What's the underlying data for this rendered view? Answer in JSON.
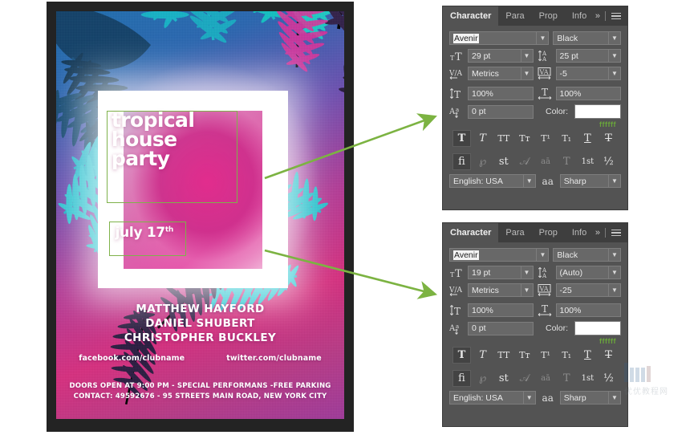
{
  "poster": {
    "title_lines": [
      "tropical",
      "house",
      "party"
    ],
    "date_text": "july 17",
    "date_sup": "th",
    "artists": [
      "MATTHEW HAYFORD",
      "DANIEL SHUBERT",
      "CHRISTOPHER BUCKLEY"
    ],
    "socials": [
      "facebook.com/clubname",
      "twitter.com/clubname"
    ],
    "footer_lines": [
      "DOORS OPEN AT 9:00 PM - SPECIAL PERFORMANS -FREE PARKING",
      "CONTACT: 49592676 - 95 STREETS MAIN ROAD, NEW YORK CITY"
    ],
    "selection_outline_color": "#7fb24a"
  },
  "annotation": {
    "arrow_color": "#7cb342",
    "arrow_count": 2
  },
  "panels": [
    {
      "id": "character-panel-title",
      "tabs": [
        {
          "label": "Character",
          "active": true
        },
        {
          "label": "Para",
          "active": false
        },
        {
          "label": "Prop",
          "active": false
        },
        {
          "label": "Info",
          "active": false
        }
      ],
      "expand_icon": "»",
      "menu_icon": "hamburger-menu-icon",
      "font_family": "Avenir",
      "font_style": "Black",
      "font_size": "29 pt",
      "leading": "25 pt",
      "kerning": "Metrics",
      "tracking": "-5",
      "vertical_scale": "100%",
      "horizontal_scale": "100%",
      "baseline_shift": "0 pt",
      "color_label": "Color:",
      "color_value": "#ffffff",
      "color_hex_note": "ffffff",
      "faux_styles": [
        {
          "name": "faux-bold",
          "glyph": "T",
          "active": true
        },
        {
          "name": "faux-italic",
          "glyph": "T",
          "active": false
        },
        {
          "name": "all-caps",
          "glyph": "TT",
          "active": false
        },
        {
          "name": "small-caps",
          "glyph": "Tᴛ",
          "active": false
        },
        {
          "name": "superscript",
          "glyph": "T¹",
          "active": false
        },
        {
          "name": "subscript",
          "glyph": "T₁",
          "active": false
        },
        {
          "name": "underline",
          "glyph": "T",
          "active": false
        },
        {
          "name": "strikethrough",
          "glyph": "T",
          "active": false
        }
      ],
      "opentype_styles": [
        {
          "name": "standard-ligatures",
          "glyph": "fi",
          "active": true,
          "dim": false
        },
        {
          "name": "contextual-alternates",
          "glyph": "℘",
          "active": false,
          "dim": true
        },
        {
          "name": "discretionary-ligatures",
          "glyph": "st",
          "active": false,
          "dim": false
        },
        {
          "name": "swash",
          "glyph": "𝒜",
          "active": false,
          "dim": true
        },
        {
          "name": "oldstyle",
          "glyph": "aā",
          "active": false,
          "dim": true
        },
        {
          "name": "titling-alternates",
          "glyph": "T",
          "active": false,
          "dim": true
        },
        {
          "name": "ordinals",
          "glyph": "1st",
          "active": false,
          "dim": false
        },
        {
          "name": "fractions",
          "glyph": "½",
          "active": false,
          "dim": false
        }
      ],
      "language": "English: USA",
      "antialias_icon": "aa",
      "antialias": "Sharp"
    },
    {
      "id": "character-panel-date",
      "tabs": [
        {
          "label": "Character",
          "active": true
        },
        {
          "label": "Para",
          "active": false
        },
        {
          "label": "Prop",
          "active": false
        },
        {
          "label": "Info",
          "active": false
        }
      ],
      "expand_icon": "»",
      "menu_icon": "hamburger-menu-icon",
      "font_family": "Avenir",
      "font_style": "Black",
      "font_size": "19 pt",
      "leading": "(Auto)",
      "kerning": "Metrics",
      "tracking": "-25",
      "vertical_scale": "100%",
      "horizontal_scale": "100%",
      "baseline_shift": "0 pt",
      "color_label": "Color:",
      "color_value": "#ffffff",
      "color_hex_note": "ffffff",
      "faux_styles": [
        {
          "name": "faux-bold",
          "glyph": "T",
          "active": true
        },
        {
          "name": "faux-italic",
          "glyph": "T",
          "active": false
        },
        {
          "name": "all-caps",
          "glyph": "TT",
          "active": false
        },
        {
          "name": "small-caps",
          "glyph": "Tᴛ",
          "active": false
        },
        {
          "name": "superscript",
          "glyph": "T¹",
          "active": false
        },
        {
          "name": "subscript",
          "glyph": "T₁",
          "active": false
        },
        {
          "name": "underline",
          "glyph": "T",
          "active": false
        },
        {
          "name": "strikethrough",
          "glyph": "T",
          "active": false
        }
      ],
      "opentype_styles": [
        {
          "name": "standard-ligatures",
          "glyph": "fi",
          "active": true,
          "dim": false
        },
        {
          "name": "contextual-alternates",
          "glyph": "℘",
          "active": false,
          "dim": true
        },
        {
          "name": "discretionary-ligatures",
          "glyph": "st",
          "active": false,
          "dim": false
        },
        {
          "name": "swash",
          "glyph": "𝒜",
          "active": false,
          "dim": true
        },
        {
          "name": "oldstyle",
          "glyph": "aā",
          "active": false,
          "dim": true
        },
        {
          "name": "titling-alternates",
          "glyph": "T",
          "active": false,
          "dim": true
        },
        {
          "name": "ordinals",
          "glyph": "1st",
          "active": false,
          "dim": false
        },
        {
          "name": "fractions",
          "glyph": "½",
          "active": false,
          "dim": false
        }
      ],
      "language": "English: USA",
      "antialias_icon": "aa",
      "antialias": "Sharp"
    }
  ],
  "watermark": {
    "text": "优优教程网"
  }
}
